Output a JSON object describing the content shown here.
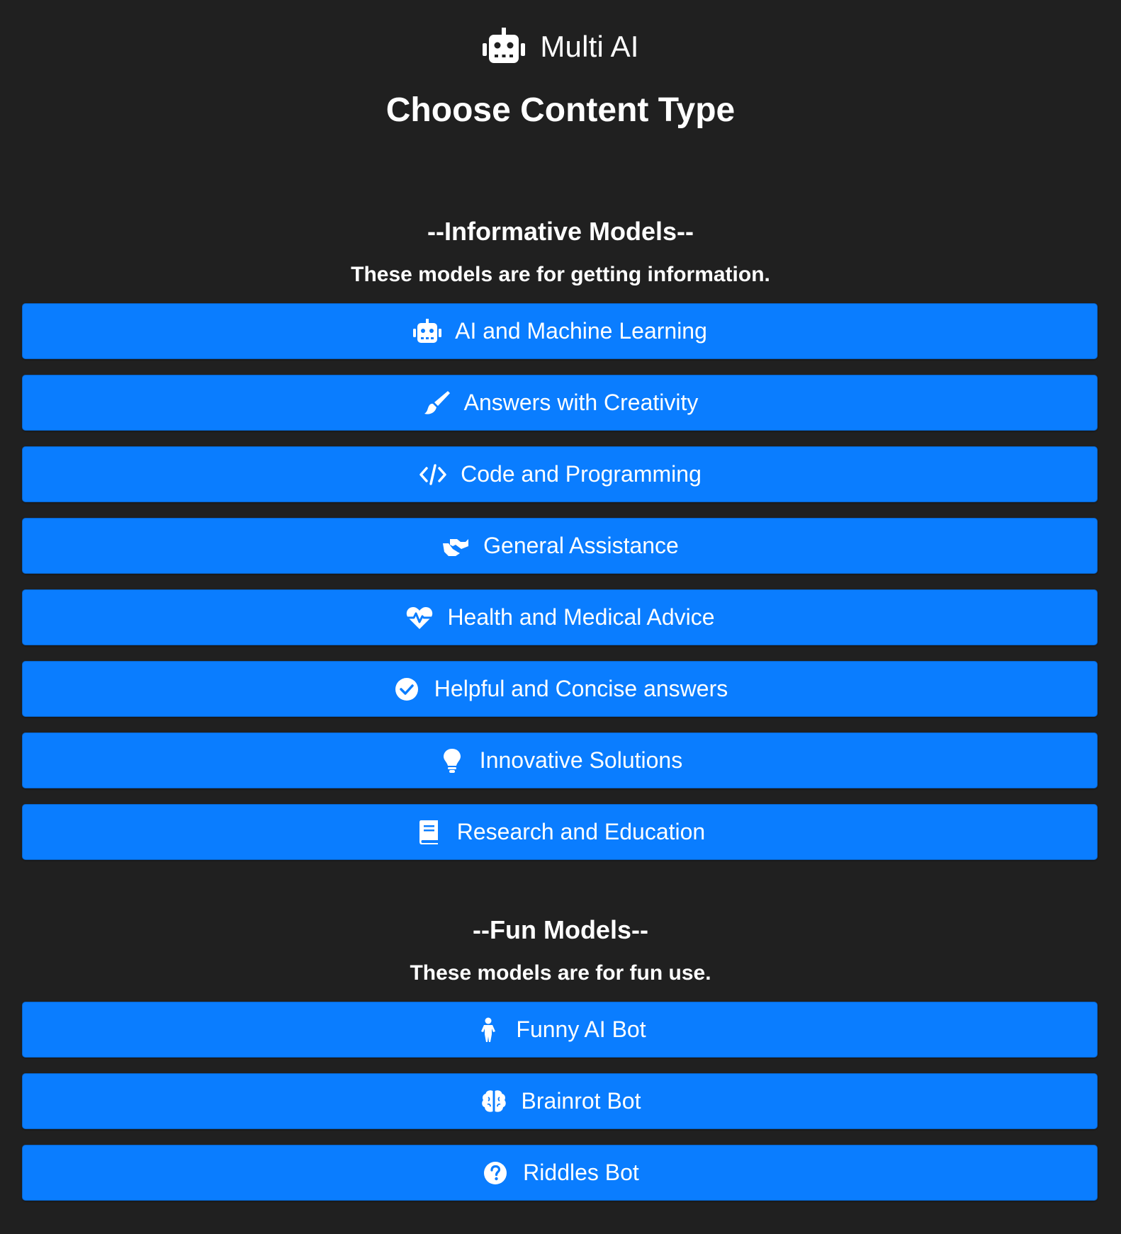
{
  "app": {
    "title": "Multi AI",
    "icon": "robot-icon"
  },
  "page_title": "Choose Content Type",
  "sections": [
    {
      "heading": "--Informative Models--",
      "subtitle": "These models are for getting information.",
      "items": [
        {
          "label": "AI and Machine Learning",
          "icon": "robot-icon"
        },
        {
          "label": "Answers with Creativity",
          "icon": "paintbrush-icon"
        },
        {
          "label": "Code and Programming",
          "icon": "code-icon"
        },
        {
          "label": "General Assistance",
          "icon": "handshake-icon"
        },
        {
          "label": "Health and Medical Advice",
          "icon": "heartbeat-icon"
        },
        {
          "label": "Helpful and Concise answers",
          "icon": "check-circle-icon"
        },
        {
          "label": "Innovative Solutions",
          "icon": "lightbulb-icon"
        },
        {
          "label": "Research and Education",
          "icon": "book-icon"
        }
      ]
    },
    {
      "heading": "--Fun Models--",
      "subtitle": "These models are for fun use.",
      "items": [
        {
          "label": "Funny AI Bot",
          "icon": "child-icon"
        },
        {
          "label": "Brainrot Bot",
          "icon": "brain-icon"
        },
        {
          "label": "Riddles Bot",
          "icon": "question-circle-icon"
        }
      ]
    }
  ],
  "colors": {
    "background": "#202020",
    "button": "#0a7dff",
    "text": "#ffffff"
  }
}
